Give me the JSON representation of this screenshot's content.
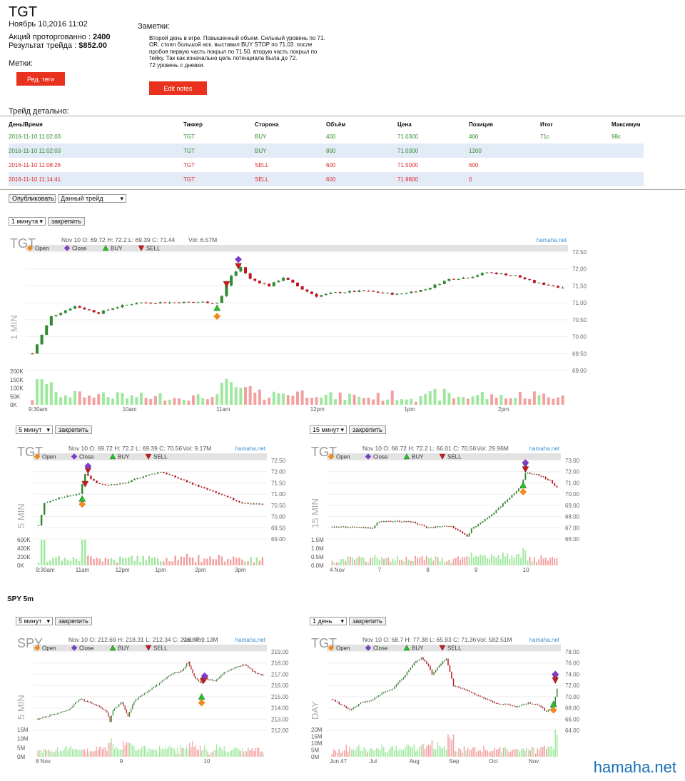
{
  "header": {
    "ticker": "TGT",
    "datetime": "Ноябрь 10,2016 11:02",
    "shares_label": "Акций проторгованно : ",
    "shares_value": "2400",
    "result_label": "Результат трейда : ",
    "result_value": "$852.00",
    "tags_label": "Метки:",
    "edit_tags_button": "Ред. теги"
  },
  "notes": {
    "label": "Заметки:",
    "text": "Второй день в игре. Повышенный объем. Сильный уровень по 71. OR. стоял большой аск. выставил BUY STOP по 71.03. после пробоя первую часть покрыл по 71.50. вторую часть покрыл по тейку. Так как изначально цель потенциала была до 72.\n72 уровень с дневки.",
    "edit_button": "Edit notes"
  },
  "trade_detail": {
    "title": "Трейд детально:",
    "columns": [
      "День/Время",
      "Тиккер",
      "Сторона",
      "Объём",
      "Цена",
      "Позиция",
      "Итог",
      "Максимум"
    ],
    "rows": [
      [
        "2016-11-10 11:02:03",
        "TGT",
        "BUY",
        "400",
        "71.0300",
        "400",
        "71c",
        "98c"
      ],
      [
        "2016-11-10 11:02:03",
        "TGT",
        "BUY",
        "800",
        "71.0300",
        "1200",
        "",
        ""
      ],
      [
        "2016-11-10 11:08:26",
        "TGT",
        "SELL",
        "600",
        "71.5000",
        "600",
        "",
        ""
      ],
      [
        "2016-11-10 11:14:41",
        "TGT",
        "SELL",
        "600",
        "71.9800",
        "0",
        "",
        ""
      ]
    ],
    "row_sides": [
      "buy",
      "buy",
      "sell",
      "sell"
    ]
  },
  "publish": {
    "publish_button": "Опубликовать",
    "scope_select": "Данный трейд"
  },
  "spy_section_label": "SPY 5m",
  "pin_label": "закрепить",
  "watermark_site": "hamaha.net",
  "legend": [
    "Open",
    "Close",
    "BUY",
    "SELL"
  ],
  "colors": {
    "up": "#2e8b2e",
    "down": "#c0141e",
    "vol_up": "#9ee89e",
    "vol_down": "#f2a0a0",
    "open": "#f08c1e",
    "close": "#7b3fc4",
    "buy": "#22c422",
    "sell": "#d01818",
    "brand": "#1a6fb5",
    "button_red": "#e8321e"
  },
  "charts": [
    {
      "id": "tgt_1min",
      "interval_select": "1 минута",
      "symbol": "TGT",
      "ohlc_text": "Nov 10 O: 69.72 H: 72.2 L: 69.39 C: 71.44",
      "vol_text": "Vol: 6.57M",
      "side_label": "1 MIN",
      "price_ticks": [
        "72.50",
        "72.00",
        "71.50",
        "71.00",
        "70.50",
        "70.00",
        "69.50",
        "69.00"
      ],
      "vol_ticks": [
        "200K",
        "150K",
        "100K",
        "50K",
        "0K"
      ],
      "x_ticks": [
        "9:30am",
        "10am",
        "11am",
        "12pm",
        "1pm",
        "2pm"
      ],
      "chart_data": {
        "type": "candlestick",
        "ylim": [
          69.0,
          72.5
        ],
        "path": [
          [
            0,
            69.5
          ],
          [
            4,
            70.6
          ],
          [
            9,
            70.9
          ],
          [
            14,
            70.7
          ],
          [
            17,
            70.85
          ],
          [
            22,
            71.0
          ],
          [
            36,
            71.02
          ],
          [
            39,
            71.0
          ],
          [
            40,
            71.2
          ],
          [
            42,
            71.8
          ],
          [
            44,
            72.05
          ],
          [
            46,
            71.7
          ],
          [
            50,
            71.5
          ],
          [
            53,
            71.75
          ],
          [
            57,
            71.4
          ],
          [
            60,
            71.2
          ],
          [
            64,
            71.3
          ],
          [
            70,
            71.35
          ],
          [
            77,
            71.25
          ],
          [
            83,
            71.4
          ],
          [
            88,
            71.7
          ],
          [
            92,
            71.75
          ],
          [
            96,
            71.9
          ],
          [
            102,
            71.8
          ],
          [
            106,
            71.6
          ],
          [
            110,
            71.5
          ],
          [
            112,
            71.45
          ]
        ],
        "volume_range": [
          0,
          200000
        ],
        "markers": [
          {
            "type": "open",
            "x": 39.0,
            "y": 70.6
          },
          {
            "type": "buy",
            "x": 39.0,
            "y": 70.85
          },
          {
            "type": "sell",
            "x": 41.0,
            "y": 71.55
          },
          {
            "type": "sell",
            "x": 43.5,
            "y": 72.08
          },
          {
            "type": "close",
            "x": 43.5,
            "y": 72.28
          }
        ]
      }
    },
    {
      "id": "tgt_5min",
      "interval_select": "5 минут",
      "symbol": "TGT",
      "ohlc_text": "Nov 10 O: 69.72 H: 72.2 L: 69.39 C: 70.56",
      "vol_text": "Vol: 9.17M",
      "side_label": "5 MIN",
      "price_ticks": [
        "72.50",
        "72.00",
        "71.50",
        "71.00",
        "70.50",
        "70.00",
        "69.50",
        "69.00"
      ],
      "vol_ticks": [
        "600K",
        "400K",
        "200K",
        "0K"
      ],
      "x_ticks": [
        "9:30am",
        "11am",
        "12pm",
        "1pm",
        "2pm",
        "3pm"
      ],
      "chart_data": {
        "type": "candlestick",
        "ylim": [
          69.0,
          72.5
        ],
        "path": [
          [
            0,
            69.6
          ],
          [
            2,
            70.6
          ],
          [
            6,
            70.8
          ],
          [
            14,
            71.0
          ],
          [
            16,
            71.9
          ],
          [
            20,
            71.5
          ],
          [
            24,
            71.4
          ],
          [
            30,
            71.5
          ],
          [
            36,
            71.8
          ],
          [
            42,
            72.0
          ],
          [
            46,
            71.8
          ],
          [
            52,
            71.5
          ],
          [
            58,
            71.2
          ],
          [
            64,
            70.9
          ],
          [
            70,
            70.6
          ],
          [
            77,
            70.55
          ]
        ],
        "volume_range": [
          0,
          600000
        ],
        "markers": [
          {
            "type": "open",
            "x": 15.0,
            "y": 70.55
          },
          {
            "type": "buy",
            "x": 15.0,
            "y": 70.8
          },
          {
            "type": "sell",
            "x": 16.0,
            "y": 71.45
          },
          {
            "type": "sell",
            "x": 17.0,
            "y": 72.05
          },
          {
            "type": "close",
            "x": 17.0,
            "y": 72.25
          }
        ]
      }
    },
    {
      "id": "tgt_15min",
      "interval_select": "15 минут",
      "symbol": "TGT",
      "ohlc_text": "Nov 10 O: 66.72 H: 72.2 L: 66.01 C: 70.56",
      "vol_text": "Vol: 29.96M",
      "side_label": "15 MIN",
      "price_ticks": [
        "73.00",
        "72.00",
        "71.00",
        "70.00",
        "69.00",
        "68.00",
        "67.00",
        "66.00"
      ],
      "vol_ticks": [
        "1.5M",
        "1.0M",
        "0.5M",
        "0.0M"
      ],
      "x_ticks": [
        "4 Nov",
        "7",
        "8",
        "9",
        "10"
      ],
      "chart_data": {
        "type": "candlestick",
        "ylim": [
          66.0,
          73.0
        ],
        "path": [
          [
            0,
            67.1
          ],
          [
            10,
            67.05
          ],
          [
            18,
            67.0
          ],
          [
            20,
            67.5
          ],
          [
            28,
            67.6
          ],
          [
            36,
            67.5
          ],
          [
            42,
            67.0
          ],
          [
            52,
            67.2
          ],
          [
            56,
            66.8
          ],
          [
            60,
            66.2
          ],
          [
            62,
            66.9
          ],
          [
            70,
            68.0
          ],
          [
            78,
            69.5
          ],
          [
            80,
            69.9
          ],
          [
            84,
            70.7
          ],
          [
            86,
            71.9
          ],
          [
            92,
            71.7
          ],
          [
            97,
            71.2
          ],
          [
            100,
            70.6
          ]
        ],
        "volume_range": [
          0,
          1500000
        ],
        "markers": [
          {
            "type": "open",
            "x": 85.0,
            "y": 70.2
          },
          {
            "type": "buy",
            "x": 85.0,
            "y": 70.8
          },
          {
            "type": "sell",
            "x": 86.0,
            "y": 72.2
          },
          {
            "type": "sell",
            "x": 86.0,
            "y": 72.6
          },
          {
            "type": "close",
            "x": 86.0,
            "y": 72.8
          }
        ]
      }
    },
    {
      "id": "spy_5min",
      "interval_select": "5 минут",
      "symbol": "SPY",
      "ohlc_text": "Nov 10 O: 212.69 H: 218.31 L: 212.34 C: 216.87",
      "vol_text": "Vol: 469.13M",
      "side_label": "5 MIN",
      "price_ticks": [
        "219.00",
        "218.00",
        "217.00",
        "216.00",
        "215.00",
        "214.00",
        "213.00",
        "212.00"
      ],
      "vol_ticks": [
        "15M",
        "10M",
        "5M",
        "0M"
      ],
      "x_ticks": [
        "8 Nov",
        "9",
        "10"
      ],
      "chart_data": {
        "type": "candlestick",
        "ylim": [
          212.0,
          219.0
        ],
        "path": [
          [
            0,
            213.0
          ],
          [
            20,
            213.8
          ],
          [
            28,
            214.8
          ],
          [
            40,
            214.2
          ],
          [
            46,
            213.6
          ],
          [
            48,
            212.8
          ],
          [
            50,
            213.8
          ],
          [
            56,
            214.5
          ],
          [
            60,
            213.2
          ],
          [
            64,
            214.6
          ],
          [
            72,
            215.4
          ],
          [
            82,
            216.3
          ],
          [
            90,
            217.1
          ],
          [
            96,
            217.3
          ],
          [
            100,
            218.1
          ],
          [
            104,
            216.8
          ],
          [
            108,
            216.2
          ],
          [
            112,
            216.6
          ],
          [
            118,
            216.4
          ],
          [
            124,
            217.2
          ],
          [
            130,
            217.5
          ],
          [
            138,
            217.9
          ],
          [
            144,
            217.2
          ],
          [
            150,
            216.9
          ]
        ],
        "volume_range": [
          0,
          15000000
        ],
        "markers": [
          {
            "type": "open",
            "x": 109.0,
            "y": 214.45
          },
          {
            "type": "buy",
            "x": 109.0,
            "y": 215.0
          },
          {
            "type": "sell",
            "x": 110.0,
            "y": 216.4
          },
          {
            "type": "sell",
            "x": 111.0,
            "y": 216.55
          },
          {
            "type": "close",
            "x": 111.0,
            "y": 216.85
          }
        ]
      }
    },
    {
      "id": "tgt_daily",
      "interval_select": "1 день",
      "symbol": "TGT",
      "ohlc_text": "Nov 10 O: 68.7 H: 77.38 L: 65.93 C: 71.36",
      "vol_text": "Vol: 582.51M",
      "side_label": "DAY",
      "price_ticks": [
        "78.00",
        "76.00",
        "74.00",
        "72.00",
        "70.00",
        "68.00",
        "66.00",
        "64.00"
      ],
      "vol_ticks": [
        "20M",
        "15M",
        "10M",
        "5M",
        "0M"
      ],
      "x_ticks": [
        "Jun 47",
        "Jul",
        "Aug",
        "Sep",
        "Oct",
        "Nov"
      ],
      "chart_data": {
        "type": "candlestick",
        "ylim": [
          64.0,
          78.0
        ],
        "path": [
          [
            0,
            69.5
          ],
          [
            5,
            68.6
          ],
          [
            10,
            67.6
          ],
          [
            16,
            68.9
          ],
          [
            22,
            69.3
          ],
          [
            28,
            70.6
          ],
          [
            34,
            71.5
          ],
          [
            40,
            73.5
          ],
          [
            46,
            76.0
          ],
          [
            50,
            77.0
          ],
          [
            54,
            75.5
          ],
          [
            56,
            74.0
          ],
          [
            60,
            75.6
          ],
          [
            64,
            76.8
          ],
          [
            68,
            72.0
          ],
          [
            74,
            71.3
          ],
          [
            80,
            70.4
          ],
          [
            86,
            69.6
          ],
          [
            92,
            68.8
          ],
          [
            98,
            68.6
          ],
          [
            104,
            68.2
          ],
          [
            110,
            68.9
          ],
          [
            116,
            68.4
          ],
          [
            120,
            67.3
          ],
          [
            124,
            68.4
          ],
          [
            126,
            71.4
          ]
        ],
        "volume_range": [
          0,
          20000000
        ],
        "markers": [
          {
            "type": "open",
            "x": 124.0,
            "y": 67.6
          },
          {
            "type": "buy",
            "x": 124.0,
            "y": 68.7
          },
          {
            "type": "sell",
            "x": 125.0,
            "y": 72.9
          },
          {
            "type": "sell",
            "x": 125.0,
            "y": 73.5
          },
          {
            "type": "close",
            "x": 125.0,
            "y": 74.0
          }
        ]
      }
    }
  ]
}
